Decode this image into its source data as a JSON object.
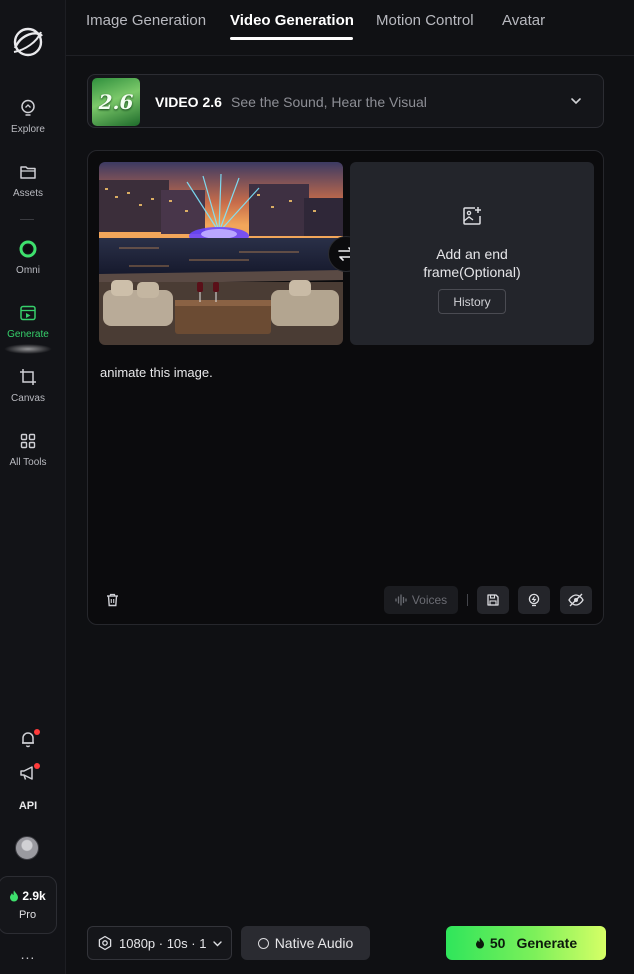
{
  "sidebar": {
    "items": [
      {
        "label": "Explore",
        "icon": "explore-bulb-icon"
      },
      {
        "label": "Assets",
        "icon": "folder-icon"
      },
      {
        "label": "Omni",
        "icon": "omni-ring-icon"
      },
      {
        "label": "Generate",
        "icon": "generate-icon",
        "active": true
      },
      {
        "label": "Canvas",
        "icon": "canvas-icon"
      },
      {
        "label": "All Tools",
        "icon": "grid-icon"
      }
    ],
    "api_label": "API",
    "credits_value": "2.9k",
    "plan_label": "Pro",
    "more_label": "...",
    "accent_color": "#36d06b"
  },
  "tabs": [
    {
      "label": "Image Generation"
    },
    {
      "label": "Video Generation",
      "active": true
    },
    {
      "label": "Motion Control"
    },
    {
      "label": "Avatar"
    }
  ],
  "model": {
    "badge": "2.6",
    "name": "VIDEO 2.6",
    "tagline": "See the Sound, Hear the Visual"
  },
  "frames": {
    "end_frame_line1": "Add an end",
    "end_frame_line2": "frame(Optional)",
    "history_label": "History"
  },
  "prompt": {
    "value": "animate this image."
  },
  "toolbar": {
    "voices_label": "Voices"
  },
  "bottom": {
    "settings_label": "1080p · 10s · 1",
    "native_audio_label": "Native Audio",
    "generate_cost": "50",
    "generate_label": "Generate"
  }
}
